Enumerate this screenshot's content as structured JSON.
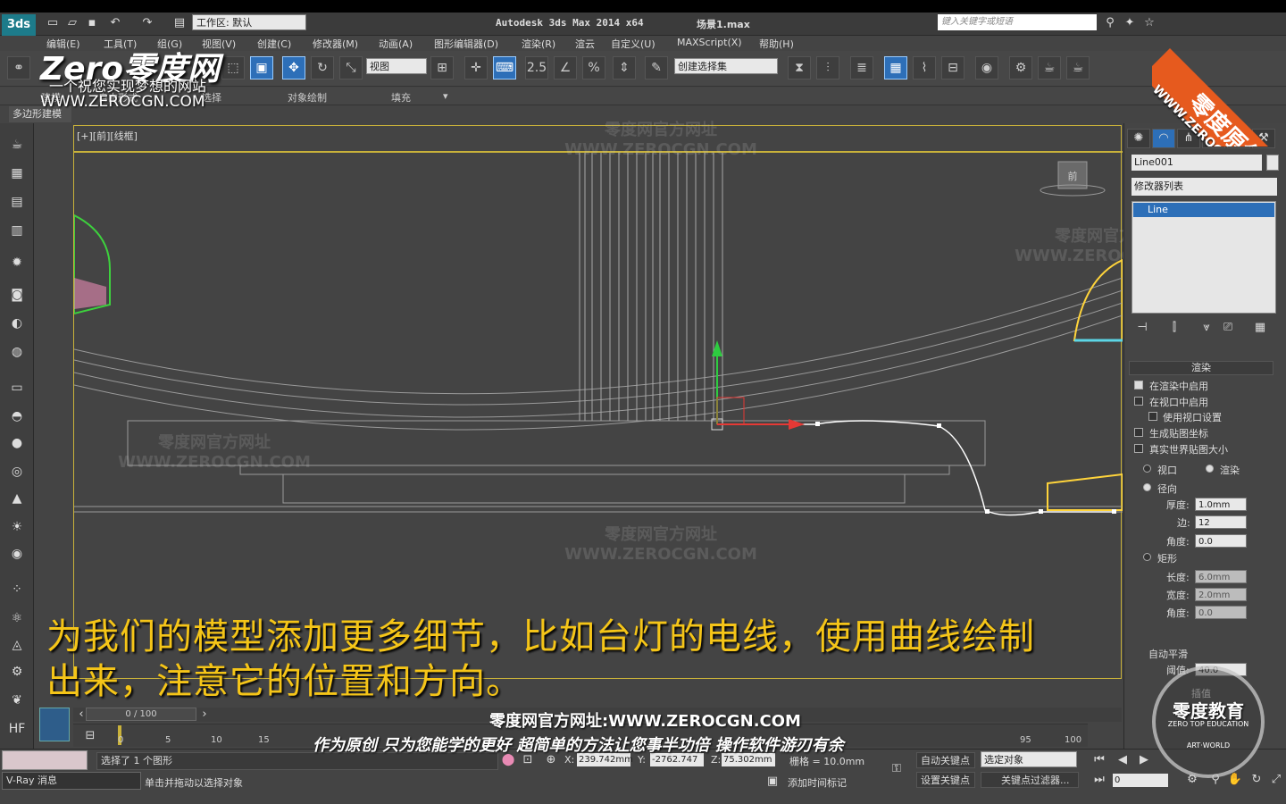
{
  "titlebar": {
    "app_title": "Autodesk 3ds Max  2014 x64",
    "scene_name": "场景1.max",
    "workspace_label": "工作区: 默认",
    "search_placeholder": "键入关键字或短语"
  },
  "menu": [
    "编辑(E)",
    "工具(T)",
    "组(G)",
    "视图(V)",
    "创建(C)",
    "修改器(M)",
    "动画(A)",
    "图形编辑器(D)",
    "渲染(R)",
    "渲云",
    "自定义(U)",
    "MAXScript(X)",
    "帮助(H)"
  ],
  "toolbar": {
    "ref_coord": "视图",
    "selection_set": "创建选择集",
    "snap_label": "2.5",
    "percent_label": "%"
  },
  "ribbon": {
    "tabs": [
      "建模",
      "自由形式",
      "选择",
      "对象绘制",
      "填充"
    ],
    "active_sub": "多边形建模"
  },
  "viewport": {
    "label": "[+][前][线框]",
    "cube_label": "前"
  },
  "command_panel": {
    "object_name": "Line001",
    "modifier_list": "修改器列表",
    "stack_item": "Line",
    "rollout_render": "渲染",
    "enable_render": "在渲染中启用",
    "enable_viewport": "在视口中启用",
    "use_viewport_settings": "使用视口设置",
    "gen_mapping": "生成贴图坐标",
    "real_world": "真实世界贴图大小",
    "viewport_radio": "视口",
    "render_radio": "渲染",
    "radial": "径向",
    "thickness_label": "厚度:",
    "thickness_value": "1.0mm",
    "sides_label": "边:",
    "sides_value": "12",
    "angle_label": "角度:",
    "angle_value": "0.0",
    "rect": "矩形",
    "length_label": "长度:",
    "length_value": "6.0mm",
    "width_label": "宽度:",
    "width_value": "2.0mm",
    "angle2_label": "角度:",
    "angle2_value": "0.0",
    "auto_smooth": "自动平滑",
    "threshold_label": "阈值:",
    "threshold_value": "40.0",
    "interp": "插值"
  },
  "subtitle": {
    "line1": "为我们的模型添加更多细节，比如台灯的电线，使用曲线绘制",
    "line2": "出来，注意它的位置和方向。"
  },
  "watermarks": {
    "logo": "Zero零度网",
    "slogan": "一个祝您实现梦想的网站",
    "url": "WWW.ZEROCGN.COM",
    "site_line": "零度网官方网址:WWW.ZEROCGN.COM",
    "motto": "作为原创 只为您能学的更好 超简单的方法让您事半功倍 操作软件游刃有余",
    "ghost_title": "零度网官方网址",
    "ghost_url": "WWW.ZEROCGN.COM",
    "corner_badge": "零度原创",
    "corner_url": "WWW.ZEROCGN.COM",
    "stamp_title": "零度教育",
    "stamp_sub": "ZERO TOP EDUCATION",
    "stamp_art": "ART·WORLD"
  },
  "timeline": {
    "frame": "0 / 100",
    "ticks": [
      "0",
      "5",
      "10",
      "15",
      "95",
      "100"
    ]
  },
  "status": {
    "selected": "选择了 1 个图形",
    "prompt": "单击并拖动以选择对象",
    "vray": "V-Ray 消息",
    "x_label": "X:",
    "x_value": "239.742mm",
    "y_label": "Y:",
    "y_value": "-2762.747",
    "z_label": "Z:",
    "z_value": "75.302mm",
    "grid": "栅格 = 10.0mm",
    "add_time_tag": "添加时间标记",
    "auto_key": "自动关键点",
    "set_key": "设置关键点",
    "selected_obj": "选定对象",
    "key_filter": "关键点过滤器...",
    "frame_value": "0"
  }
}
